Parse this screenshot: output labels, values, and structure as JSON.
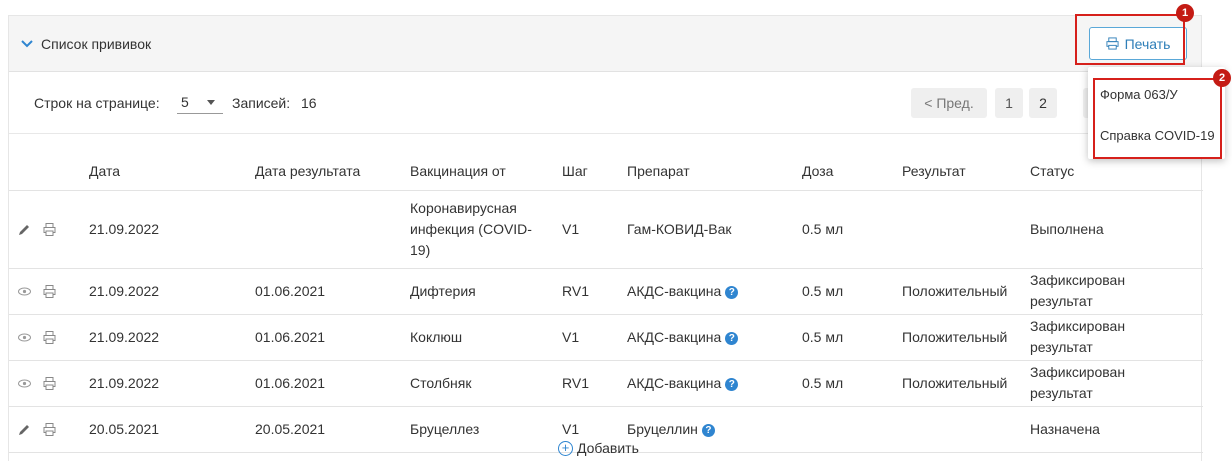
{
  "section": {
    "title": "Список прививок"
  },
  "print_button": {
    "label": "Печать"
  },
  "pager": {
    "rows_label": "Строк на странице:",
    "rows_value": "5",
    "records_label": "Записей:",
    "records_count": "16",
    "prev_label": "< Пред.",
    "pages": [
      "1",
      "2"
    ]
  },
  "table": {
    "headers": [
      "Дата",
      "Дата результата",
      "Вакцинация от",
      "Шаг",
      "Препарат",
      "Доза",
      "Результат",
      "Статус"
    ],
    "rows": [
      {
        "icon1": "pencil-icon",
        "icon2": "printer-icon",
        "date": "21.09.2022",
        "result_date": "",
        "vaccination": "Коронавирусная инфекция (COVID-19)",
        "step": "V1",
        "drug": "Гам-КОВИД-Вак",
        "drug_help": false,
        "dose": "0.5 мл",
        "result": "",
        "status": "Выполнена"
      },
      {
        "icon1": "eye-icon",
        "icon2": "printer-icon",
        "date": "21.09.2022",
        "result_date": "01.06.2021",
        "vaccination": "Дифтерия",
        "step": "RV1",
        "drug": "АКДС-вакцина",
        "drug_help": true,
        "dose": "0.5 мл",
        "result": "Положительный",
        "status": "Зафиксирован результат"
      },
      {
        "icon1": "eye-icon",
        "icon2": "printer-icon",
        "date": "21.09.2022",
        "result_date": "01.06.2021",
        "vaccination": "Коклюш",
        "step": "V1",
        "drug": "АКДС-вакцина",
        "drug_help": true,
        "dose": "0.5 мл",
        "result": "Положительный",
        "status": "Зафиксирован результат"
      },
      {
        "icon1": "eye-icon",
        "icon2": "printer-icon",
        "date": "21.09.2022",
        "result_date": "01.06.2021",
        "vaccination": "Столбняк",
        "step": "RV1",
        "drug": "АКДС-вакцина",
        "drug_help": true,
        "dose": "0.5 мл",
        "result": "Положительный",
        "status": "Зафиксирован результат"
      },
      {
        "icon1": "pencil-icon",
        "icon2": "printer-icon",
        "date": "20.05.2021",
        "result_date": "20.05.2021",
        "vaccination": "Бруцеллез",
        "step": "V1",
        "drug": "Бруцеллин",
        "drug_help": true,
        "dose": "",
        "result": "",
        "status": "Назначена"
      }
    ]
  },
  "add_button": {
    "label": "Добавить"
  },
  "print_menu": {
    "items": [
      "Форма 063/У",
      "Справка COVID-19"
    ]
  },
  "markers": [
    "1",
    "2"
  ],
  "colors": {
    "accent": "#2f85d0",
    "highlight": "#d6201b",
    "header_bg": "#f5f5f5"
  }
}
